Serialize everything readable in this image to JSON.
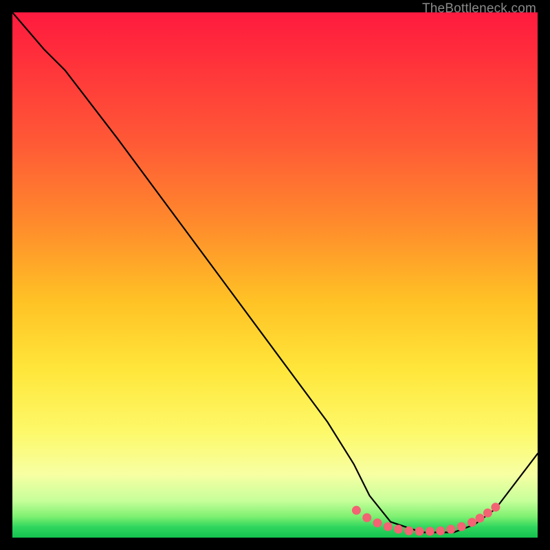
{
  "watermark": "TheBottleneck.com",
  "chart_data": {
    "type": "line",
    "title": "",
    "xlabel": "",
    "ylabel": "",
    "xlim": [
      0,
      100
    ],
    "ylim": [
      0,
      100
    ],
    "series": [
      {
        "name": "curve",
        "x": [
          0,
          6,
          10,
          20,
          30,
          40,
          50,
          60,
          65,
          68,
          72,
          78,
          84,
          88,
          92,
          100
        ],
        "y": [
          100,
          93,
          89,
          76,
          62.5,
          49,
          35.5,
          22,
          14,
          8,
          3,
          1,
          1,
          2.5,
          5.5,
          16
        ]
      }
    ],
    "highlight": {
      "name": "bottom-dots",
      "color": "#f26373",
      "points_x": [
        65.5,
        67.5,
        69.5,
        71.5,
        73.5,
        75.5,
        77.5,
        79.5,
        81.5,
        83.5,
        85.5,
        87.5,
        89,
        90.5,
        92
      ],
      "points_y": [
        5.2,
        3.8,
        2.8,
        2.1,
        1.6,
        1.3,
        1.2,
        1.2,
        1.3,
        1.6,
        2.1,
        2.9,
        3.7,
        4.7,
        5.8
      ]
    },
    "background_gradient_stops": [
      {
        "pos": 0.0,
        "color": "#ff1a3f"
      },
      {
        "pos": 0.25,
        "color": "#ff5a36"
      },
      {
        "pos": 0.55,
        "color": "#ffc225"
      },
      {
        "pos": 0.8,
        "color": "#fdf96a"
      },
      {
        "pos": 0.96,
        "color": "#7ef070"
      },
      {
        "pos": 1.0,
        "color": "#14c24e"
      }
    ]
  }
}
